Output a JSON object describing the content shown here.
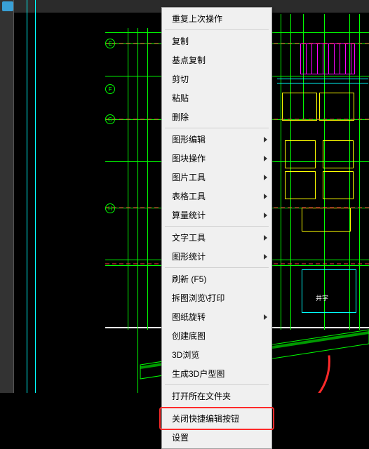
{
  "context_menu": {
    "groups": [
      [
        {
          "label": "重复上次操作",
          "submenu": false
        }
      ],
      [
        {
          "label": "复制",
          "submenu": false
        },
        {
          "label": "基点复制",
          "submenu": false
        },
        {
          "label": "剪切",
          "submenu": false
        },
        {
          "label": "粘贴",
          "submenu": false
        },
        {
          "label": "删除",
          "submenu": false
        }
      ],
      [
        {
          "label": "图形编辑",
          "submenu": true
        },
        {
          "label": "图块操作",
          "submenu": true
        },
        {
          "label": "图片工具",
          "submenu": true
        },
        {
          "label": "表格工具",
          "submenu": true
        },
        {
          "label": "算量统计",
          "submenu": true
        }
      ],
      [
        {
          "label": "文字工具",
          "submenu": true
        },
        {
          "label": "图形统计",
          "submenu": true
        }
      ],
      [
        {
          "label": "刷新 (F5)",
          "submenu": false
        },
        {
          "label": "拆图浏览\\打印",
          "submenu": false
        },
        {
          "label": "图纸旋转",
          "submenu": true
        },
        {
          "label": "创建底图",
          "submenu": false
        },
        {
          "label": "3D浏览",
          "submenu": false
        },
        {
          "label": "生成3D户型图",
          "submenu": false
        }
      ],
      [
        {
          "label": "打开所在文件夹",
          "submenu": false
        }
      ],
      [
        {
          "label": "关闭快捷编辑按钮",
          "submenu": false,
          "highlighted": true
        },
        {
          "label": "设置",
          "submenu": false
        }
      ]
    ]
  },
  "grid_labels": {
    "rows": [
      "E",
      "F",
      "G",
      "H"
    ]
  },
  "cad_text": {
    "small_label": "井字"
  },
  "annotation": {
    "type": "arrow",
    "color": "#ff2a2a",
    "points_to": "关闭快捷编辑按钮"
  }
}
